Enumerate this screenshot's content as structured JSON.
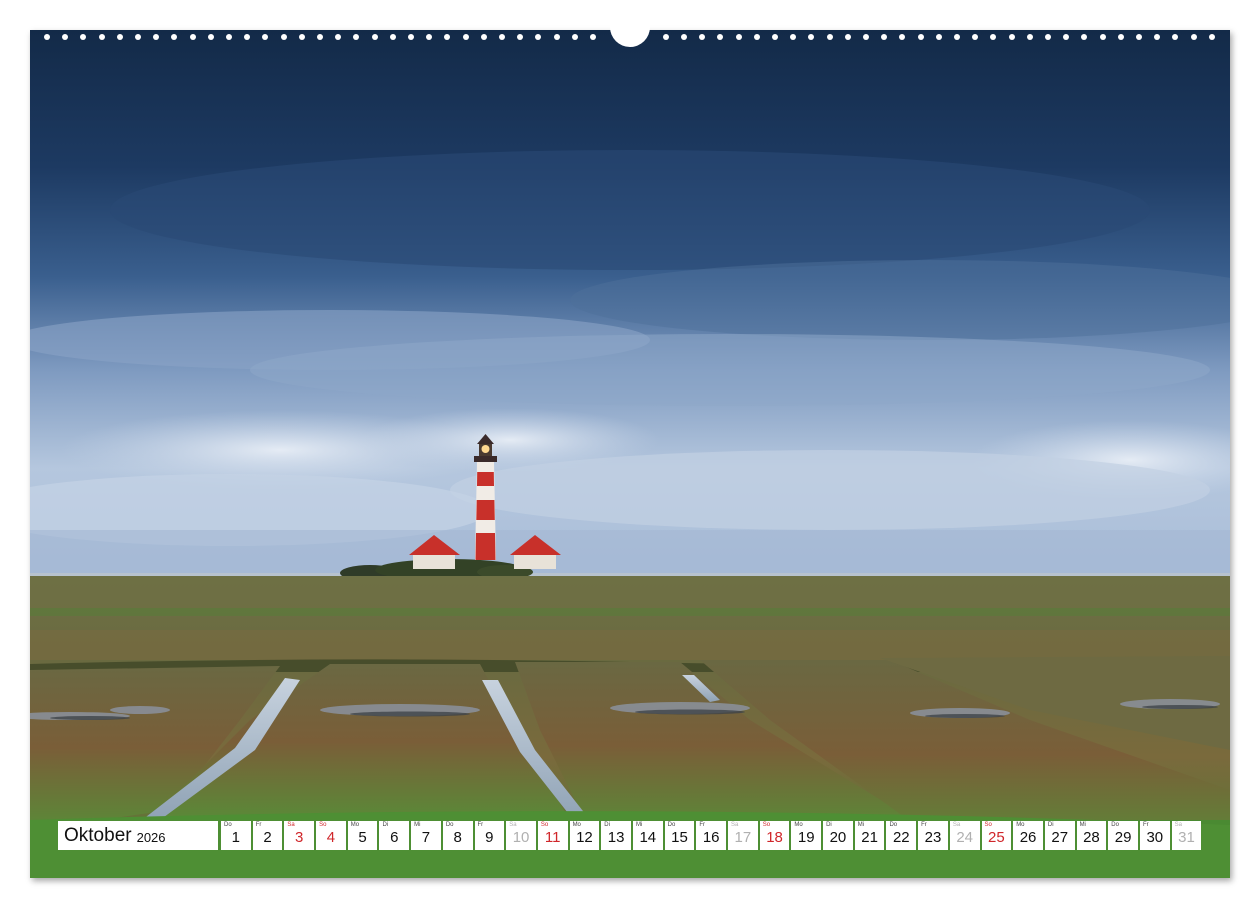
{
  "calendar": {
    "month": "Oktober",
    "year": "2026",
    "days": [
      {
        "n": "1",
        "wd": "Do",
        "type": "weekday"
      },
      {
        "n": "2",
        "wd": "Fr",
        "type": "weekday"
      },
      {
        "n": "3",
        "wd": "Sa",
        "type": "sun"
      },
      {
        "n": "4",
        "wd": "So",
        "type": "sun"
      },
      {
        "n": "5",
        "wd": "Mo",
        "type": "weekday"
      },
      {
        "n": "6",
        "wd": "Di",
        "type": "weekday"
      },
      {
        "n": "7",
        "wd": "Mi",
        "type": "weekday"
      },
      {
        "n": "8",
        "wd": "Do",
        "type": "weekday"
      },
      {
        "n": "9",
        "wd": "Fr",
        "type": "weekday"
      },
      {
        "n": "10",
        "wd": "Sa",
        "type": "sat"
      },
      {
        "n": "11",
        "wd": "So",
        "type": "sun"
      },
      {
        "n": "12",
        "wd": "Mo",
        "type": "weekday"
      },
      {
        "n": "13",
        "wd": "Di",
        "type": "weekday"
      },
      {
        "n": "14",
        "wd": "Mi",
        "type": "weekday"
      },
      {
        "n": "15",
        "wd": "Do",
        "type": "weekday"
      },
      {
        "n": "16",
        "wd": "Fr",
        "type": "weekday"
      },
      {
        "n": "17",
        "wd": "Sa",
        "type": "sat"
      },
      {
        "n": "18",
        "wd": "So",
        "type": "sun"
      },
      {
        "n": "19",
        "wd": "Mo",
        "type": "weekday"
      },
      {
        "n": "20",
        "wd": "Di",
        "type": "weekday"
      },
      {
        "n": "21",
        "wd": "Mi",
        "type": "weekday"
      },
      {
        "n": "22",
        "wd": "Do",
        "type": "weekday"
      },
      {
        "n": "23",
        "wd": "Fr",
        "type": "weekday"
      },
      {
        "n": "24",
        "wd": "Sa",
        "type": "sat"
      },
      {
        "n": "25",
        "wd": "So",
        "type": "sun"
      },
      {
        "n": "26",
        "wd": "Mo",
        "type": "weekday"
      },
      {
        "n": "27",
        "wd": "Di",
        "type": "weekday"
      },
      {
        "n": "28",
        "wd": "Mi",
        "type": "weekday"
      },
      {
        "n": "29",
        "wd": "Do",
        "type": "weekday"
      },
      {
        "n": "30",
        "wd": "Fr",
        "type": "weekday"
      },
      {
        "n": "31",
        "wd": "Sa",
        "type": "sat"
      }
    ]
  },
  "colors": {
    "sunday_red": "#d0262a",
    "saturday_gray": "#b0b0b0",
    "lighthouse_red": "#c8302a",
    "sky_dark": "#1b3558",
    "marsh_green": "#5a6a35"
  }
}
